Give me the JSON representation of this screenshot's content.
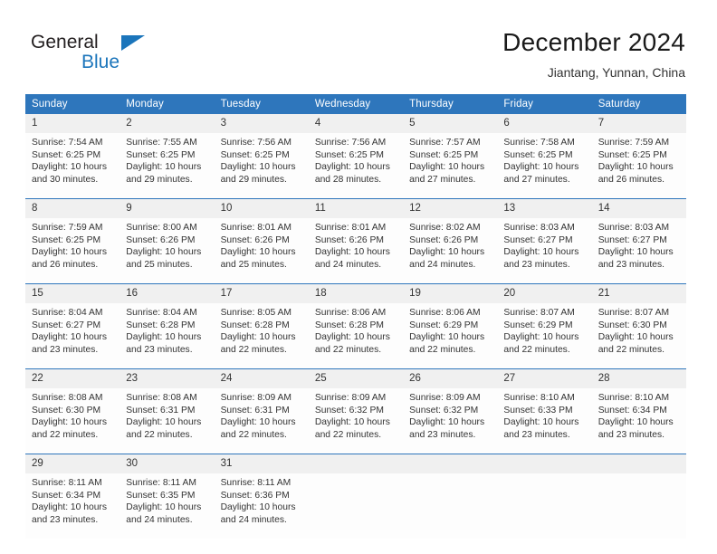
{
  "brand": {
    "line1": "General",
    "line2": "Blue",
    "triangle_color": "#1b75bb"
  },
  "header": {
    "title": "December 2024",
    "subtitle": "Jiantang, Yunnan, China"
  },
  "theme": {
    "header_bg": "#2e76bc",
    "daynum_bg": "#f0f0f0",
    "cell_bg": "#fdfdfd",
    "text": "#333333"
  },
  "labels": {
    "sunrise_prefix": "Sunrise:",
    "sunset_prefix": "Sunset:",
    "daylight_prefix": "Daylight:"
  },
  "weekday_headers": [
    "Sunday",
    "Monday",
    "Tuesday",
    "Wednesday",
    "Thursday",
    "Friday",
    "Saturday"
  ],
  "weeks": [
    [
      {
        "day": "1",
        "sunrise": "Sunrise: 7:54 AM",
        "sunset": "Sunset: 6:25 PM",
        "daylight": "Daylight: 10 hours and 30 minutes."
      },
      {
        "day": "2",
        "sunrise": "Sunrise: 7:55 AM",
        "sunset": "Sunset: 6:25 PM",
        "daylight": "Daylight: 10 hours and 29 minutes."
      },
      {
        "day": "3",
        "sunrise": "Sunrise: 7:56 AM",
        "sunset": "Sunset: 6:25 PM",
        "daylight": "Daylight: 10 hours and 29 minutes."
      },
      {
        "day": "4",
        "sunrise": "Sunrise: 7:56 AM",
        "sunset": "Sunset: 6:25 PM",
        "daylight": "Daylight: 10 hours and 28 minutes."
      },
      {
        "day": "5",
        "sunrise": "Sunrise: 7:57 AM",
        "sunset": "Sunset: 6:25 PM",
        "daylight": "Daylight: 10 hours and 27 minutes."
      },
      {
        "day": "6",
        "sunrise": "Sunrise: 7:58 AM",
        "sunset": "Sunset: 6:25 PM",
        "daylight": "Daylight: 10 hours and 27 minutes."
      },
      {
        "day": "7",
        "sunrise": "Sunrise: 7:59 AM",
        "sunset": "Sunset: 6:25 PM",
        "daylight": "Daylight: 10 hours and 26 minutes."
      }
    ],
    [
      {
        "day": "8",
        "sunrise": "Sunrise: 7:59 AM",
        "sunset": "Sunset: 6:25 PM",
        "daylight": "Daylight: 10 hours and 26 minutes."
      },
      {
        "day": "9",
        "sunrise": "Sunrise: 8:00 AM",
        "sunset": "Sunset: 6:26 PM",
        "daylight": "Daylight: 10 hours and 25 minutes."
      },
      {
        "day": "10",
        "sunrise": "Sunrise: 8:01 AM",
        "sunset": "Sunset: 6:26 PM",
        "daylight": "Daylight: 10 hours and 25 minutes."
      },
      {
        "day": "11",
        "sunrise": "Sunrise: 8:01 AM",
        "sunset": "Sunset: 6:26 PM",
        "daylight": "Daylight: 10 hours and 24 minutes."
      },
      {
        "day": "12",
        "sunrise": "Sunrise: 8:02 AM",
        "sunset": "Sunset: 6:26 PM",
        "daylight": "Daylight: 10 hours and 24 minutes."
      },
      {
        "day": "13",
        "sunrise": "Sunrise: 8:03 AM",
        "sunset": "Sunset: 6:27 PM",
        "daylight": "Daylight: 10 hours and 23 minutes."
      },
      {
        "day": "14",
        "sunrise": "Sunrise: 8:03 AM",
        "sunset": "Sunset: 6:27 PM",
        "daylight": "Daylight: 10 hours and 23 minutes."
      }
    ],
    [
      {
        "day": "15",
        "sunrise": "Sunrise: 8:04 AM",
        "sunset": "Sunset: 6:27 PM",
        "daylight": "Daylight: 10 hours and 23 minutes."
      },
      {
        "day": "16",
        "sunrise": "Sunrise: 8:04 AM",
        "sunset": "Sunset: 6:28 PM",
        "daylight": "Daylight: 10 hours and 23 minutes."
      },
      {
        "day": "17",
        "sunrise": "Sunrise: 8:05 AM",
        "sunset": "Sunset: 6:28 PM",
        "daylight": "Daylight: 10 hours and 22 minutes."
      },
      {
        "day": "18",
        "sunrise": "Sunrise: 8:06 AM",
        "sunset": "Sunset: 6:28 PM",
        "daylight": "Daylight: 10 hours and 22 minutes."
      },
      {
        "day": "19",
        "sunrise": "Sunrise: 8:06 AM",
        "sunset": "Sunset: 6:29 PM",
        "daylight": "Daylight: 10 hours and 22 minutes."
      },
      {
        "day": "20",
        "sunrise": "Sunrise: 8:07 AM",
        "sunset": "Sunset: 6:29 PM",
        "daylight": "Daylight: 10 hours and 22 minutes."
      },
      {
        "day": "21",
        "sunrise": "Sunrise: 8:07 AM",
        "sunset": "Sunset: 6:30 PM",
        "daylight": "Daylight: 10 hours and 22 minutes."
      }
    ],
    [
      {
        "day": "22",
        "sunrise": "Sunrise: 8:08 AM",
        "sunset": "Sunset: 6:30 PM",
        "daylight": "Daylight: 10 hours and 22 minutes."
      },
      {
        "day": "23",
        "sunrise": "Sunrise: 8:08 AM",
        "sunset": "Sunset: 6:31 PM",
        "daylight": "Daylight: 10 hours and 22 minutes."
      },
      {
        "day": "24",
        "sunrise": "Sunrise: 8:09 AM",
        "sunset": "Sunset: 6:31 PM",
        "daylight": "Daylight: 10 hours and 22 minutes."
      },
      {
        "day": "25",
        "sunrise": "Sunrise: 8:09 AM",
        "sunset": "Sunset: 6:32 PM",
        "daylight": "Daylight: 10 hours and 22 minutes."
      },
      {
        "day": "26",
        "sunrise": "Sunrise: 8:09 AM",
        "sunset": "Sunset: 6:32 PM",
        "daylight": "Daylight: 10 hours and 23 minutes."
      },
      {
        "day": "27",
        "sunrise": "Sunrise: 8:10 AM",
        "sunset": "Sunset: 6:33 PM",
        "daylight": "Daylight: 10 hours and 23 minutes."
      },
      {
        "day": "28",
        "sunrise": "Sunrise: 8:10 AM",
        "sunset": "Sunset: 6:34 PM",
        "daylight": "Daylight: 10 hours and 23 minutes."
      }
    ],
    [
      {
        "day": "29",
        "sunrise": "Sunrise: 8:11 AM",
        "sunset": "Sunset: 6:34 PM",
        "daylight": "Daylight: 10 hours and 23 minutes."
      },
      {
        "day": "30",
        "sunrise": "Sunrise: 8:11 AM",
        "sunset": "Sunset: 6:35 PM",
        "daylight": "Daylight: 10 hours and 24 minutes."
      },
      {
        "day": "31",
        "sunrise": "Sunrise: 8:11 AM",
        "sunset": "Sunset: 6:36 PM",
        "daylight": "Daylight: 10 hours and 24 minutes."
      },
      {
        "day": "",
        "sunrise": "",
        "sunset": "",
        "daylight": ""
      },
      {
        "day": "",
        "sunrise": "",
        "sunset": "",
        "daylight": ""
      },
      {
        "day": "",
        "sunrise": "",
        "sunset": "",
        "daylight": ""
      },
      {
        "day": "",
        "sunrise": "",
        "sunset": "",
        "daylight": ""
      }
    ]
  ]
}
